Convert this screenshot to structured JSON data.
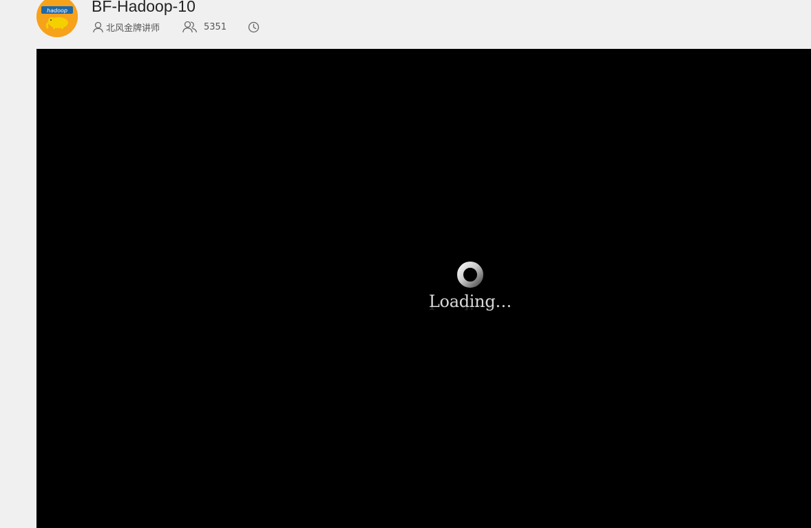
{
  "header": {
    "title": "BF-Hadoop-10",
    "logo_text": "hadoop",
    "author": "北风金牌讲师",
    "view_count": "5351",
    "icons": {
      "author": "user-icon",
      "views": "users-icon",
      "duration": "clock-icon"
    }
  },
  "player": {
    "loading_text": "Loading…",
    "background_color": "#000000"
  },
  "colors": {
    "page_background": "#f0f0f0",
    "logo_background": "#f7a21b",
    "title_text": "#222222"
  }
}
